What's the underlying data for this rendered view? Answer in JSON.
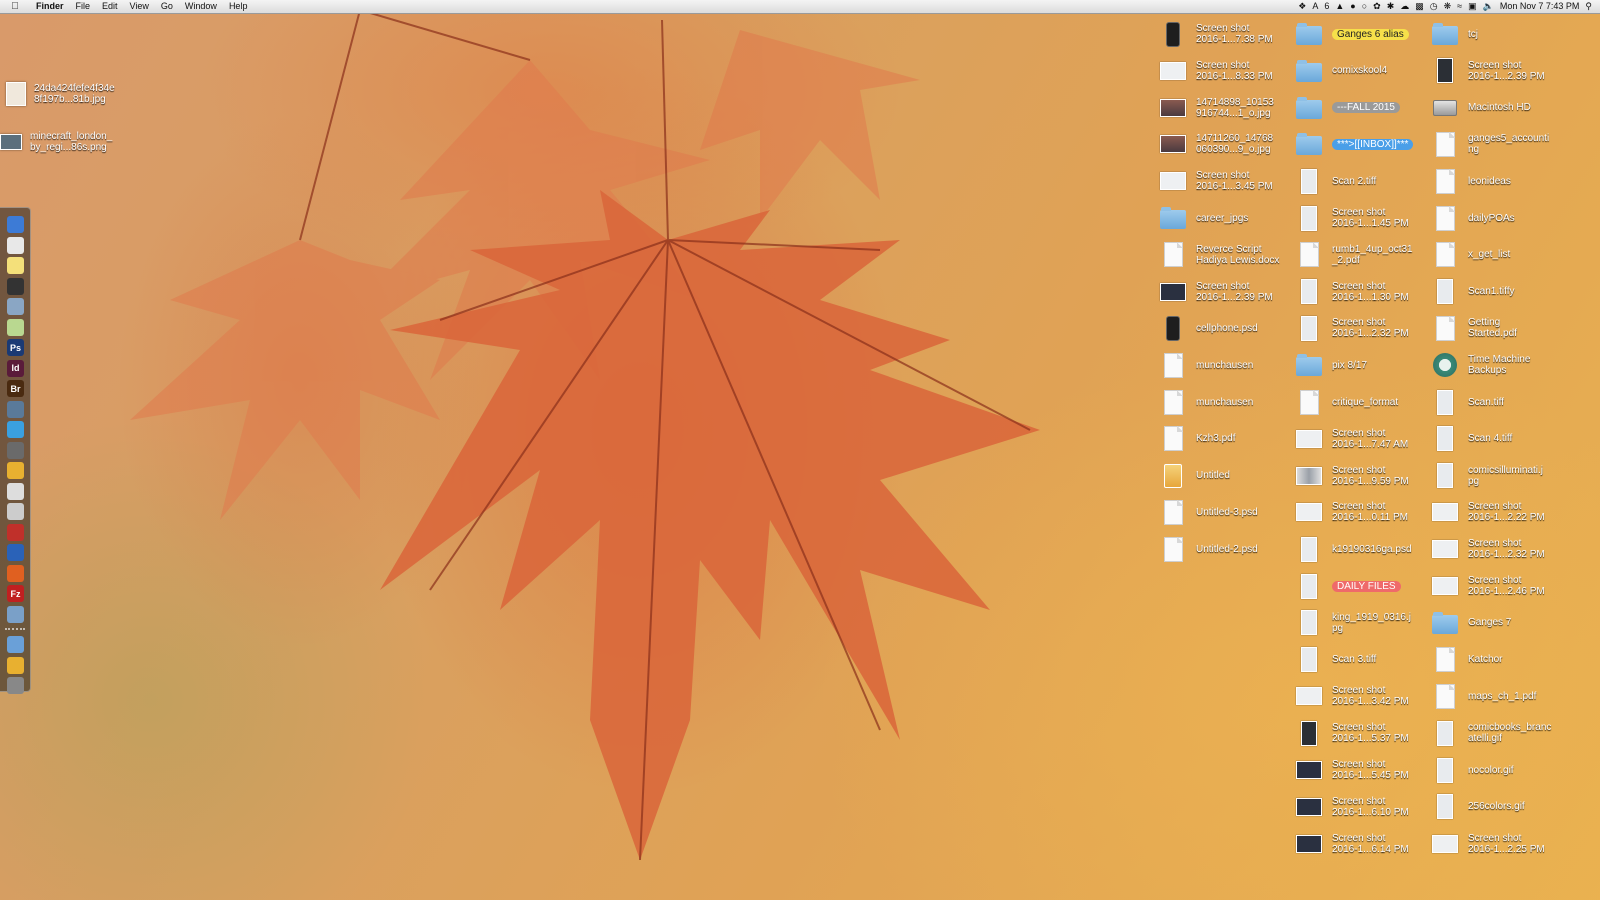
{
  "menubar": {
    "app": "Finder",
    "menus": [
      "File",
      "Edit",
      "View",
      "Go",
      "Window",
      "Help"
    ],
    "status_badge": "6",
    "clock": "Mon Nov 7  7:43 PM"
  },
  "left_files": [
    {
      "label": "24da424fefe4f34e\n8f197b...81b.jpg"
    },
    {
      "label": "minecraft_london_\nby_regi...86s.png"
    }
  ],
  "dock_icons": [
    "finder-icon",
    "calendar-icon",
    "stickies-icon",
    "app-icon",
    "preview-icon",
    "pencil-icon",
    "Ps",
    "Id",
    "Br",
    "scanner-icon",
    "skype-icon",
    "monitor-icon",
    "chrome-color-icon",
    "printer-icon",
    "printer-icon",
    "acrobat-icon",
    "globe-icon",
    "firefox-icon",
    "Fz",
    "preview-icon",
    "folder-icon",
    "chrome-icon",
    "trash-icon"
  ],
  "desktop": {
    "col1": [
      {
        "label": "Screen shot\n2016-1...7.38 PM",
        "icon": "phone"
      },
      {
        "label": "Screen shot\n2016-1...8.33 PM",
        "icon": "shot"
      },
      {
        "label": "14714898_10153\n916744...1_o.jpg",
        "icon": "photo"
      },
      {
        "label": "14711260_14768\n060390...9_o.jpg",
        "icon": "photo"
      },
      {
        "label": "Screen shot\n2016-1...3.45 PM",
        "icon": "shot"
      },
      {
        "label": "career_jpgs",
        "icon": "folder"
      },
      {
        "label": "Reverce Script\nHadiya Lewis.docx",
        "icon": "doc"
      },
      {
        "label": "Screen shot\n2016-1...2.39 PM",
        "icon": "dark"
      },
      {
        "label": "cellphone.psd",
        "icon": "phone"
      },
      {
        "label": "munchausen",
        "icon": "doc"
      },
      {
        "label": "munchausen",
        "icon": "doc"
      },
      {
        "label": "Kzh3.pdf",
        "icon": "doc"
      },
      {
        "label": "Untitled",
        "icon": "usb"
      },
      {
        "label": "Untitled-3.psd",
        "icon": "doc"
      },
      {
        "label": "Untitled-2.psd",
        "icon": "doc"
      }
    ],
    "col2": [
      {
        "label": "Ganges 6 alias",
        "icon": "folder",
        "tag": "yellow"
      },
      {
        "label": "comixskool4",
        "icon": "folder"
      },
      {
        "label": "---FALL 2015",
        "icon": "folder",
        "tag": "gray"
      },
      {
        "label": "***>[[INBOX]]***",
        "icon": "folder",
        "tag": "blue"
      },
      {
        "label": "Scan 2.tiff",
        "icon": "tall"
      },
      {
        "label": "Screen shot\n2016-1...1.45 PM",
        "icon": "tall"
      },
      {
        "label": "rumb1_4up_oct31\n_2.pdf",
        "icon": "doc"
      },
      {
        "label": "Screen shot\n2016-1...1.30 PM",
        "icon": "tall"
      },
      {
        "label": "Screen shot\n2016-1...2.32 PM",
        "icon": "tall"
      },
      {
        "label": "pix 8/17",
        "icon": "folder"
      },
      {
        "label": "critique_format",
        "icon": "doc"
      },
      {
        "label": "Screen shot\n2016-1...7.47 AM",
        "icon": "shot"
      },
      {
        "label": "Screen shot\n2016-1...9.59 PM",
        "icon": "mid"
      },
      {
        "label": "Screen shot\n2016-1...0.11 PM",
        "icon": "shot"
      },
      {
        "label": "k19190316ga.psd",
        "icon": "tall"
      },
      {
        "label": "DAILY FILES",
        "icon": "tall",
        "tag": "red"
      },
      {
        "label": "king_1919_0316.j\npg",
        "icon": "tall"
      },
      {
        "label": "Scan 3.tiff",
        "icon": "tall"
      },
      {
        "label": "Screen shot\n2016-1...3.42 PM",
        "icon": "shot"
      },
      {
        "label": "Screen shot\n2016-1...5.37 PM",
        "icon": "talldark"
      },
      {
        "label": "Screen shot\n2016-1...5.45 PM",
        "icon": "dark"
      },
      {
        "label": "Screen shot\n2016-1...6.10 PM",
        "icon": "dark"
      },
      {
        "label": "Screen shot\n2016-1...6.14 PM",
        "icon": "dark"
      }
    ],
    "col3": [
      {
        "label": "tcj",
        "icon": "folder"
      },
      {
        "label": "Screen shot\n2016-1...2.39 PM",
        "icon": "talldark"
      },
      {
        "label": "Macintosh HD",
        "icon": "hd"
      },
      {
        "label": "ganges5_accounti\nng",
        "icon": "doc"
      },
      {
        "label": "leonideas",
        "icon": "doc"
      },
      {
        "label": "dailyPOAs",
        "icon": "doc"
      },
      {
        "label": "x_get_list",
        "icon": "doc"
      },
      {
        "label": "Scan1.tiffy",
        "icon": "tall"
      },
      {
        "label": "Getting\nStarted.pdf",
        "icon": "doc"
      },
      {
        "label": "Time Machine\nBackups",
        "icon": "tm"
      },
      {
        "label": "Scan.tiff",
        "icon": "tall"
      },
      {
        "label": "Scan 4.tiff",
        "icon": "tall"
      },
      {
        "label": "comicsilluminati.j\npg",
        "icon": "tall"
      },
      {
        "label": "Screen shot\n2016-1...2.22 PM",
        "icon": "shot"
      },
      {
        "label": "Screen shot\n2016-1...2.32 PM",
        "icon": "shot"
      },
      {
        "label": "Screen shot\n2016-1...2.46 PM",
        "icon": "shot"
      },
      {
        "label": "Ganges 7",
        "icon": "folder"
      },
      {
        "label": "Katchor",
        "icon": "doc"
      },
      {
        "label": "maps_ch_1.pdf",
        "icon": "doc"
      },
      {
        "label": "comicbooks_branc\natelli.gif",
        "icon": "tall"
      },
      {
        "label": "nocolor.gif",
        "icon": "tall"
      },
      {
        "label": "256colors.gif",
        "icon": "tall"
      },
      {
        "label": "Screen shot\n2016-1...2.25 PM",
        "icon": "shot"
      }
    ]
  }
}
